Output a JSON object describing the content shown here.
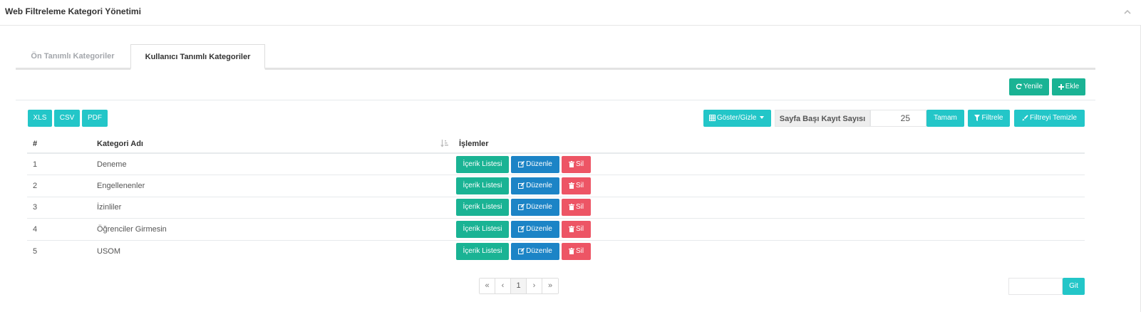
{
  "panel": {
    "title": "Web Filtreleme Kategori Yönetimi",
    "collapse_icon": "chevron-up-icon"
  },
  "tabs": [
    {
      "label": "Ön Tanımlı Kategoriler",
      "active": false
    },
    {
      "label": "Kullanıcı Tanımlı Kategoriler",
      "active": true
    }
  ],
  "toolbar": {
    "refresh_label": "Yenile",
    "add_label": "Ekle"
  },
  "export": {
    "xls": "XLS",
    "csv": "CSV",
    "pdf": "PDF"
  },
  "controls": {
    "columns_label": "Göster/Gizle",
    "page_size_label": "Sayfa Başı Kayıt Sayısı",
    "page_size_value": "25",
    "ok_label": "Tamam",
    "filter_label": "Filtrele",
    "clear_filter_label": "Filtreyi Temizle"
  },
  "table": {
    "headers": [
      "#",
      "Kategori Adı",
      "İşlemler"
    ],
    "rows": [
      {
        "num": "1",
        "name": "Deneme"
      },
      {
        "num": "2",
        "name": "Engellenenler"
      },
      {
        "num": "3",
        "name": "İzinliler"
      },
      {
        "num": "4",
        "name": "Öğrenciler Girmesin"
      },
      {
        "num": "5",
        "name": "USOM"
      }
    ],
    "actions": {
      "list": "İçerik Listesi",
      "edit": "Düzenle",
      "delete": "Sil"
    }
  },
  "pagination": {
    "first": "«",
    "prev": "‹",
    "current": "1",
    "next": "›",
    "last": "»"
  },
  "goto": {
    "value": "",
    "button": "Git"
  },
  "colors": {
    "green": "#1ab394",
    "teal": "#23c6c8",
    "blue": "#1c84c6",
    "red": "#ed5565"
  }
}
